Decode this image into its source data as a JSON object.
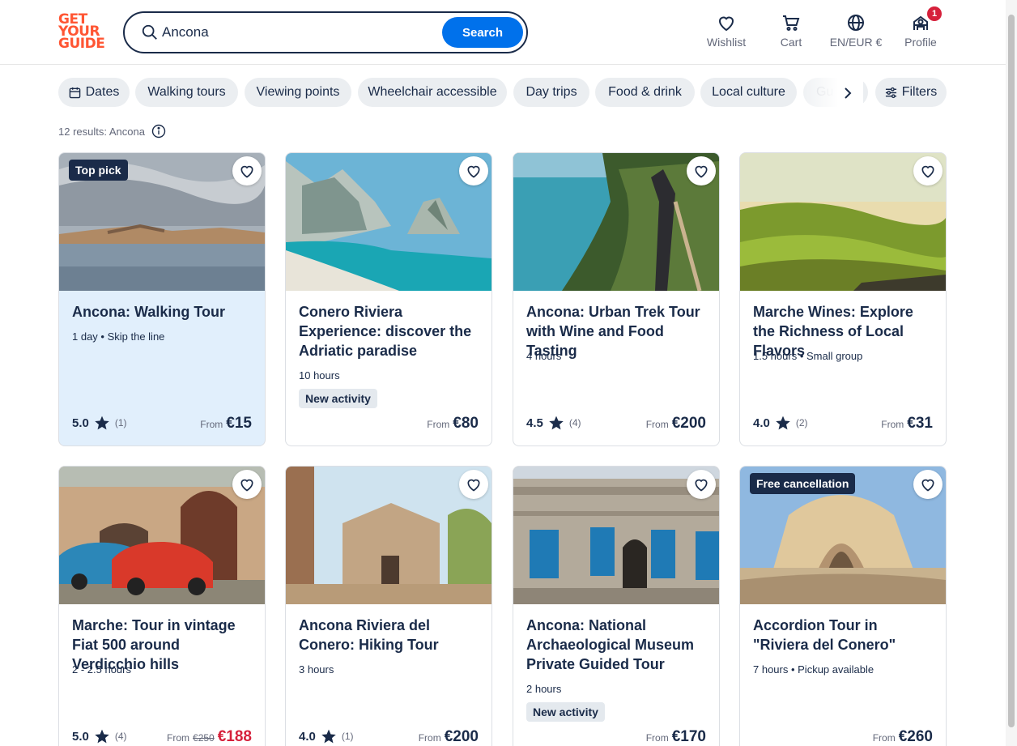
{
  "brand": {
    "logo_line1": "GET",
    "logo_line2": "YOUR",
    "logo_line3": "GUIDE",
    "color": "#ff5533"
  },
  "search": {
    "value": "Ancona",
    "button": "Search"
  },
  "header": {
    "wishlist": "Wishlist",
    "cart": "Cart",
    "language": "EN/EUR €",
    "profile": "Profile",
    "profile_badge": "1"
  },
  "filters": {
    "chips": [
      "Dates",
      "Walking tours",
      "Viewing points",
      "Wheelchair accessible",
      "Day trips",
      "Food & drink",
      "Local culture",
      "Gu"
    ],
    "filters_label": "Filters"
  },
  "results": {
    "text": "12 results: Ancona"
  },
  "cards": [
    {
      "tag": "Top pick",
      "title": "Ancona: Walking Tour",
      "meta": "1 day • Skip the line",
      "rating": "5.0",
      "count": "(1)",
      "from": "From",
      "price": "€15"
    },
    {
      "title": "Conero Riviera Experience: discover the Adriatic paradise",
      "meta": "10 hours",
      "badge": "New activity",
      "from": "From",
      "price": "€80"
    },
    {
      "title": "Ancona: Urban Trek Tour with Wine and Food Tasting",
      "meta": "4 hours",
      "rating": "4.5",
      "count": "(4)",
      "from": "From",
      "price": "€200"
    },
    {
      "title": "Marche Wines: Explore the Richness of Local Flavors",
      "meta": "1.5 hours • Small group",
      "rating": "4.0",
      "count": "(2)",
      "from": "From",
      "price": "€31"
    },
    {
      "title": "Marche: Tour in vintage Fiat 500 around Verdicchio hills",
      "meta": "2 - 2.5 hours",
      "rating": "5.0",
      "count": "(4)",
      "from": "From",
      "old_price": "€250",
      "price": "€188"
    },
    {
      "title": "Ancona Riviera del Conero: Hiking Tour",
      "meta": "3 hours",
      "rating": "4.0",
      "count": "(1)",
      "from": "From",
      "price": "€200"
    },
    {
      "title": "Ancona: National Archaeological Museum Private Guided Tour",
      "meta": "2 hours",
      "badge": "New activity",
      "from": "From",
      "price": "€170"
    },
    {
      "tag": "Free cancellation",
      "title": "Accordion Tour in \"Riviera del Conero\"",
      "meta": "7 hours • Pickup available",
      "from": "From",
      "price": "€260"
    }
  ],
  "colors": {
    "accent": "#0071eb",
    "text": "#1a2b49",
    "sale": "#d6203b",
    "highlight": "#e1effc"
  }
}
